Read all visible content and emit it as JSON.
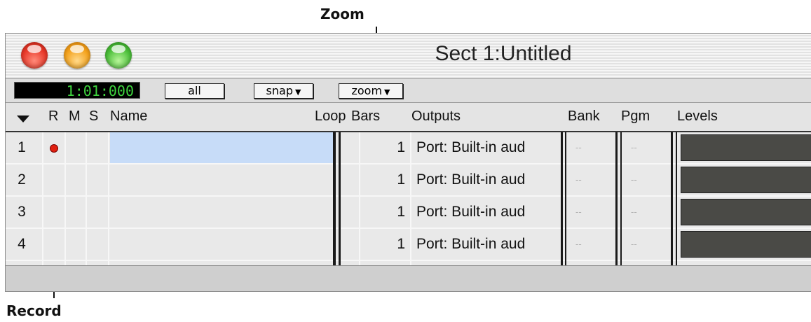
{
  "callouts": {
    "top": "Zoom",
    "bottom": "Record"
  },
  "window": {
    "title": "Sect 1:Untitled",
    "counter": "1:01:000",
    "buttons": {
      "all": "all",
      "snap": "snap",
      "zoom": "zoom"
    }
  },
  "columns": {
    "R": "R",
    "M": "M",
    "S": "S",
    "name": "Name",
    "loop": "Loop",
    "bars": "Bars",
    "outputs": "Outputs",
    "bank": "Bank",
    "pgm": "Pgm",
    "levels": "Levels"
  },
  "tracks": [
    {
      "num": "1",
      "bars": "1",
      "output": "Port: Built-in aud",
      "bank": "--",
      "pgm": "--",
      "record": true,
      "selected": true
    },
    {
      "num": "2",
      "bars": "1",
      "output": "Port: Built-in aud",
      "bank": "--",
      "pgm": "--",
      "record": false,
      "selected": false
    },
    {
      "num": "3",
      "bars": "1",
      "output": "Port: Built-in aud",
      "bank": "--",
      "pgm": "--",
      "record": false,
      "selected": false
    },
    {
      "num": "4",
      "bars": "1",
      "output": "Port: Built-in aud",
      "bank": "--",
      "pgm": "--",
      "record": false,
      "selected": false
    }
  ],
  "colors": {
    "counter_text": "#3fd43f",
    "selection": "#c7dcf8",
    "record_dot": "#e02010",
    "level_meter": "#4a4a46"
  }
}
